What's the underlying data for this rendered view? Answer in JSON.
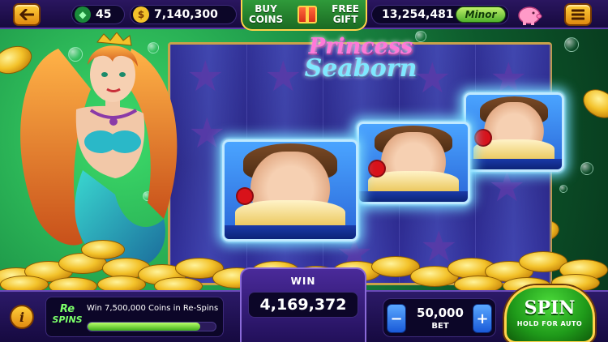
{
  "topbar": {
    "gems": "45",
    "coins": "7,140,300",
    "buy_label": "BUY\nCOINS",
    "gift_label": "FREE\nGIFT",
    "jackpot": "13,254,481",
    "jackpot_tier": "Minor"
  },
  "game": {
    "title_line1": "Princess",
    "title_line2": "Seaborn"
  },
  "bottom": {
    "respin_logo_1": "Re",
    "respin_logo_2": "SPINS",
    "respin_message": "Win 7,500,000 Coins in Re-Spins",
    "respin_progress": 0.88,
    "win_label": "WIN",
    "win_value": "4,169,372",
    "bet_value": "50,000",
    "bet_label": "BET",
    "spin_label": "SPIN",
    "spin_sub": "HOLD FOR AUTO"
  },
  "colors": {
    "accent_gold": "#ffcf3a",
    "background_green": "#1f9a4a",
    "panel_purple": "#2c1a68",
    "spin_green": "#1f9a1a"
  }
}
